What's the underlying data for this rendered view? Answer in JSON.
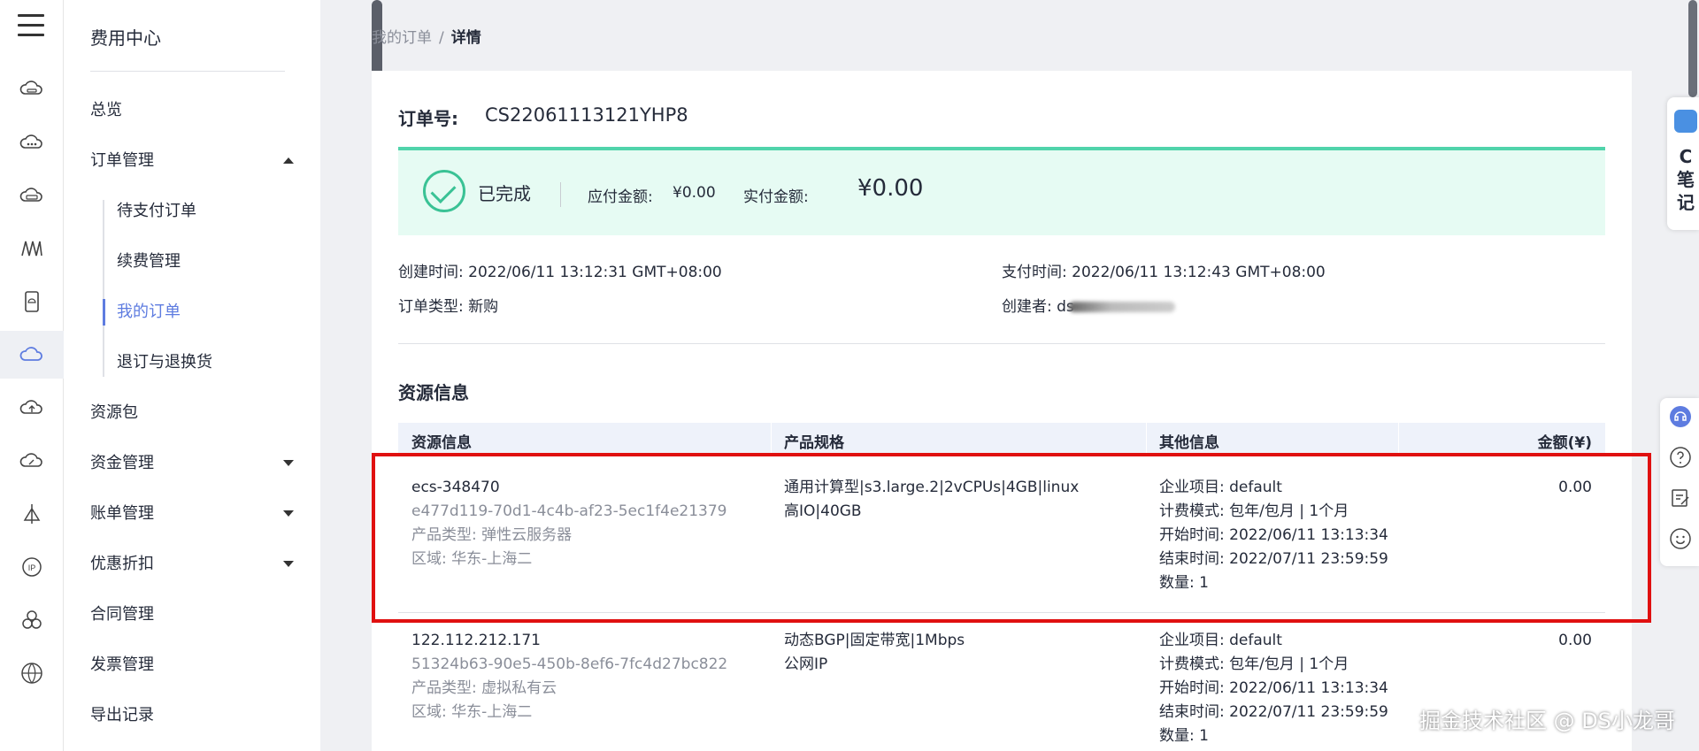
{
  "rail": {
    "icons": [
      "menu-icon",
      "cloud-server-icon",
      "cloud-dots-icon",
      "cloud-disk-icon",
      "waves-icon",
      "device-icon",
      "cloud-active-icon",
      "cloud-upload-icon",
      "cloud-speed-icon",
      "network-icon",
      "ip-icon",
      "cluster-icon",
      "globe-icon"
    ]
  },
  "menu": {
    "title": "费用中心",
    "items": {
      "overview": "总览",
      "orders": "订单管理",
      "pending": "待支付订单",
      "renewal": "续费管理",
      "my_orders": "我的订单",
      "refund": "退订与退换货",
      "packages": "资源包",
      "funds": "资金管理",
      "bills": "账单管理",
      "discounts": "优惠折扣",
      "contracts": "合同管理",
      "invoices": "发票管理",
      "exports": "导出记录"
    }
  },
  "breadcrumb": {
    "parent": "我的订单",
    "sep": "/",
    "current": "详情"
  },
  "order": {
    "label": "订单号:",
    "number": "CS22061113121YHP8",
    "status": "已完成",
    "due_label": "应付金额:",
    "due_value": "¥0.00",
    "paid_label": "实付金额:",
    "paid_value": "¥0.00",
    "created_label": "创建时间:",
    "created_value": "2022/06/11 13:12:31 GMT+08:00",
    "paytime_label": "支付时间:",
    "paytime_value": "2022/06/11 13:12:43 GMT+08:00",
    "type_label": "订单类型:",
    "type_value": "新购",
    "creator_label": "创建者:",
    "creator_value": "ds"
  },
  "resources": {
    "title": "资源信息",
    "headers": {
      "resource": "资源信息",
      "spec": "产品规格",
      "other": "其他信息",
      "amount": "金额(¥)"
    },
    "rows": [
      {
        "name": "ecs-348470",
        "id": "e477d119-70d1-4c4b-af23-5ec1f4e21379",
        "product_type": "产品类型: 弹性云服务器",
        "region": "区域: 华东-上海二",
        "spec1": "通用计算型|s3.large.2|2vCPUs|4GB|linux",
        "spec2": "高IO|40GB",
        "project": "企业项目: default",
        "billing": "计费模式: 包年/包月 | 1个月",
        "start": "开始时间: 2022/06/11 13:13:34",
        "end": "结束时间: 2022/07/11 23:59:59",
        "qty": "数量: 1",
        "amount": "0.00"
      },
      {
        "name": "122.112.212.171",
        "id": "51324b63-90e5-450b-8ef6-7fc4d27bc822",
        "product_type": "产品类型: 虚拟私有云",
        "region": "区域: 华东-上海二",
        "spec1": "动态BGP|固定带宽|1Mbps",
        "spec2": "公网IP",
        "project": "企业项目: default",
        "billing": "计费模式: 包年/包月 | 1个月",
        "start": "开始时间: 2022/06/11 13:13:34",
        "end": "结束时间: 2022/07/11 23:59:59",
        "qty": "数量: 1",
        "amount": "0.00"
      }
    ]
  },
  "float": {
    "note": "C笔记"
  },
  "watermark": "掘金技术社区 @ DS小龙哥",
  "colors": {
    "accent": "#5e7ce0",
    "success": "#3ac295",
    "status_bg": "#e6fbf3",
    "highlight": "#e01010"
  }
}
